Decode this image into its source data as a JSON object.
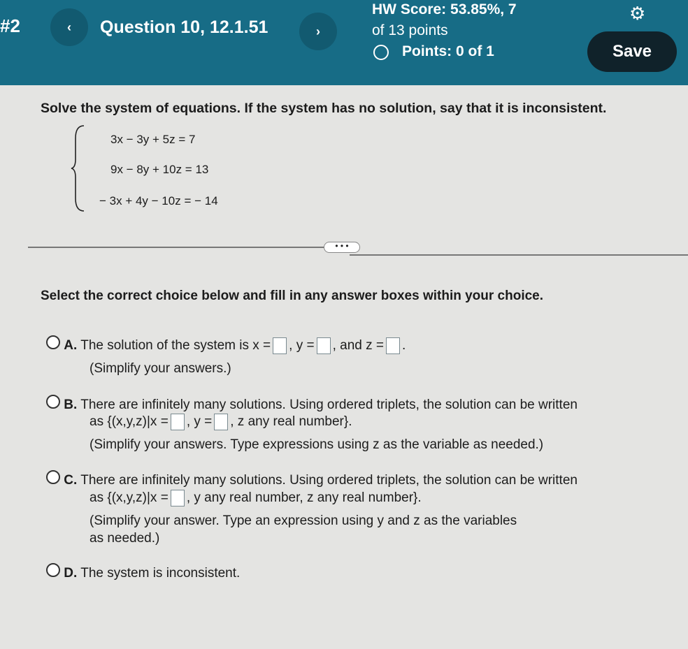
{
  "header": {
    "set_label": "#2",
    "question_title": "Question 10, 12.1.51",
    "hw_score_line1": "HW Score: 53.85%, 7",
    "hw_score_line2": "of 13 points",
    "points": "Points: 0 of 1",
    "save_label": "Save",
    "prev": "‹",
    "next": "›",
    "settings_icon": "gear-icon"
  },
  "question": {
    "prompt": "Solve the system of equations. If the system has no solution, say that it is inconsistent.",
    "equations": [
      "3x − 3y +  5z = 7",
      "9x − 8y + 10z = 13",
      "− 3x + 4y − 10z = − 14"
    ]
  },
  "more_label": "• • •",
  "instruction": "Select the correct choice below and fill in any answer boxes within your choice.",
  "choices": {
    "a": {
      "letter": "A.",
      "t1": "The solution of the system is x =",
      "t2": ", y =",
      "t3": ", and z =",
      "t4": ".",
      "note": "(Simplify your answers.)"
    },
    "b": {
      "letter": "B.",
      "line1": "There are infinitely many solutions. Using ordered triplets, the solution can be written",
      "t1": "as {(x,y,z)|x =",
      "t2": ", y =",
      "t3": ", z any real number}.",
      "note": "(Simplify your answers. Type expressions using z as the variable as needed.)"
    },
    "c": {
      "letter": "C.",
      "line1": "There are infinitely many solutions. Using ordered triplets, the solution can be written",
      "t1": "as {(x,y,z)|x =",
      "t2": ", y any real number, z any real number}.",
      "note1": "(Simplify your answer. Type an expression using y and z as the variables",
      "note2": "as needed.)"
    },
    "d": {
      "letter": "D.",
      "line1": "The system is inconsistent."
    }
  }
}
